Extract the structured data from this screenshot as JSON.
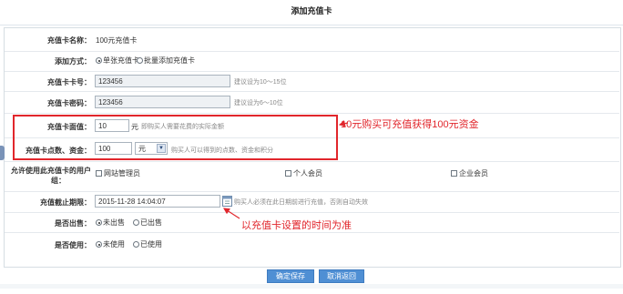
{
  "page_title": "添加充值卡",
  "form": {
    "card_name": {
      "label": "充值卡名称：",
      "value": "100元充值卡"
    },
    "add_mode": {
      "label": "添加方式：",
      "options": [
        "单张充值卡",
        "批量添加充值卡"
      ],
      "selected": "单张充值卡"
    },
    "card_number": {
      "label": "充值卡卡号：",
      "value": "123456",
      "hint": "建议设为10～15位"
    },
    "card_password": {
      "label": "充值卡密码：",
      "value": "123456",
      "hint": "建议设为6～10位"
    },
    "face_value": {
      "label": "充值卡面值：",
      "value": "10",
      "unit": "元",
      "hint": "即购买人需要花费的实际金额"
    },
    "points": {
      "label": "充值卡点数、资金：",
      "value": "100",
      "unit_selected": "元",
      "hint": "购买人可以得到的点数、资金和积分"
    },
    "allowed_groups": {
      "label_line1": "允许使用此充值卡的用户",
      "label_line2": "组：",
      "options": [
        "网站管理员",
        "个人会员",
        "企业会员"
      ]
    },
    "expiry": {
      "label": "充值截止期限：",
      "value": "2015-11-28 14:04:07",
      "hint": "购买人必须在此日期前进行充值，否则自动失效"
    },
    "sold": {
      "label": "是否出售：",
      "options": [
        "未出售",
        "已出售"
      ],
      "selected": "未出售"
    },
    "used": {
      "label": "是否使用：",
      "options": [
        "未使用",
        "已使用"
      ],
      "selected": "未使用"
    }
  },
  "buttons": {
    "save": "确定保存(O)",
    "back": "取消返回(C)"
  },
  "annotations": {
    "face_value_note": "10元购买可充值获得100元资金",
    "expiry_note": "以充值卡设置的时间为准"
  },
  "colors": {
    "annotation_red": "#e1262c",
    "button_blue": "#4f8fd4"
  }
}
